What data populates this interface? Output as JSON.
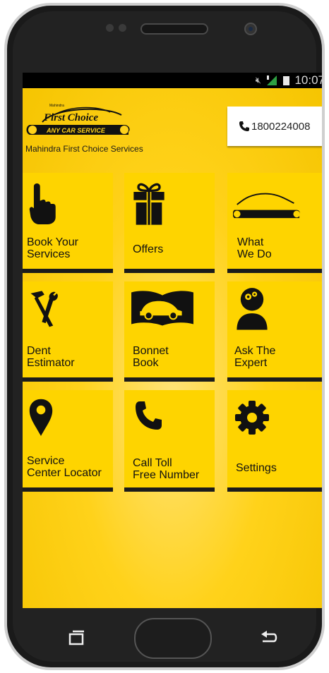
{
  "status_bar": {
    "time": "10:07",
    "icons": [
      "mute-icon",
      "signal-icon",
      "battery-icon"
    ]
  },
  "header": {
    "logo_top": "First Choice",
    "logo_bottom": "ANY CAR SERVICE",
    "logo_small": "Mahindra",
    "brand_text": "Mahindra First Choice Services",
    "toll_number": "1800224008"
  },
  "tiles": [
    {
      "line1": "Book Your",
      "line2": "Services",
      "icon": "hand-pointer-icon"
    },
    {
      "line1": "Offers",
      "line2": "",
      "icon": "gift-icon"
    },
    {
      "line1": "What",
      "line2": "We Do",
      "icon": "car-wrench-icon"
    },
    {
      "line1": "Dent",
      "line2": "Estimator",
      "icon": "hammer-icon"
    },
    {
      "line1": "Bonnet",
      "line2": "Book",
      "icon": "car-book-icon"
    },
    {
      "line1": "Ask The",
      "line2": "Expert",
      "icon": "expert-icon"
    },
    {
      "line1": "Service",
      "line2": "Center Locator",
      "icon": "location-pin-icon"
    },
    {
      "line1": "Call Toll",
      "line2": "Free Number",
      "icon": "phone-icon"
    },
    {
      "line1": "Settings",
      "line2": "",
      "icon": "gear-icon"
    }
  ],
  "colors": {
    "tile": "#fed400",
    "background": "#ffd21a",
    "bar": "#1b1b1b"
  }
}
